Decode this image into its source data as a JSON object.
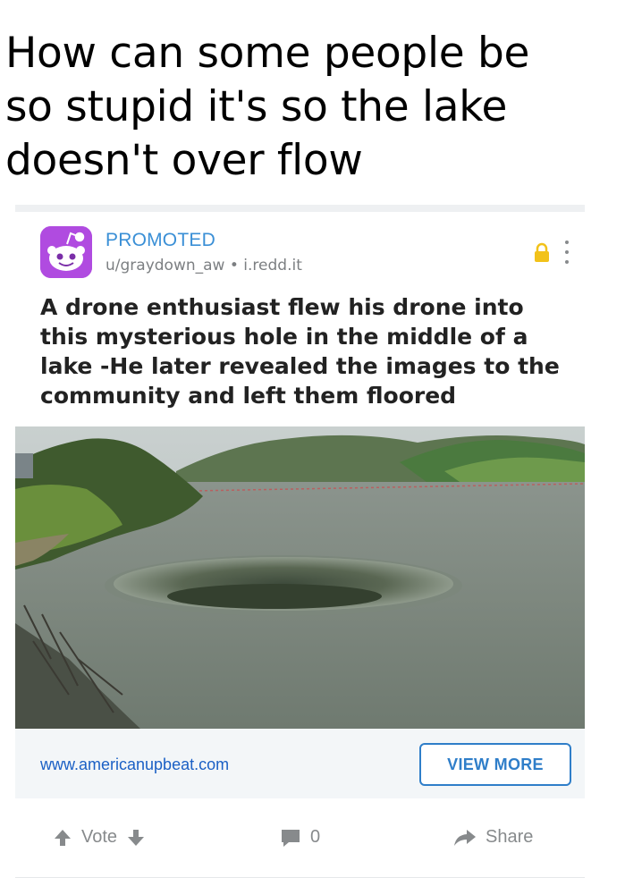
{
  "caption": {
    "line1": "How can some people be",
    "line2": "so stupid it's so the lake",
    "line3": "doesn't over flow"
  },
  "post": {
    "promoted_label": "PROMOTED",
    "author": "u/graydown_aw",
    "separator": "•",
    "domain": "i.redd.it",
    "title": "A drone enthusiast flew his drone into this mysterious hole in the middle of a lake -He later revealed the images to the community and left them floored",
    "lock_icon": "lock-icon",
    "more_icon": "more-vertical-icon"
  },
  "link": {
    "url": "www.americanupbeat.com",
    "cta": "VIEW MORE"
  },
  "actions": {
    "vote_label": "Vote",
    "comment_count": "0",
    "share_label": "Share"
  },
  "colors": {
    "promoted": "#3a8fd6",
    "avatar_bg": "#b04be0",
    "lock": "#f2c21a",
    "link": "#1b60c5",
    "cta_border": "#2f7ec9"
  }
}
